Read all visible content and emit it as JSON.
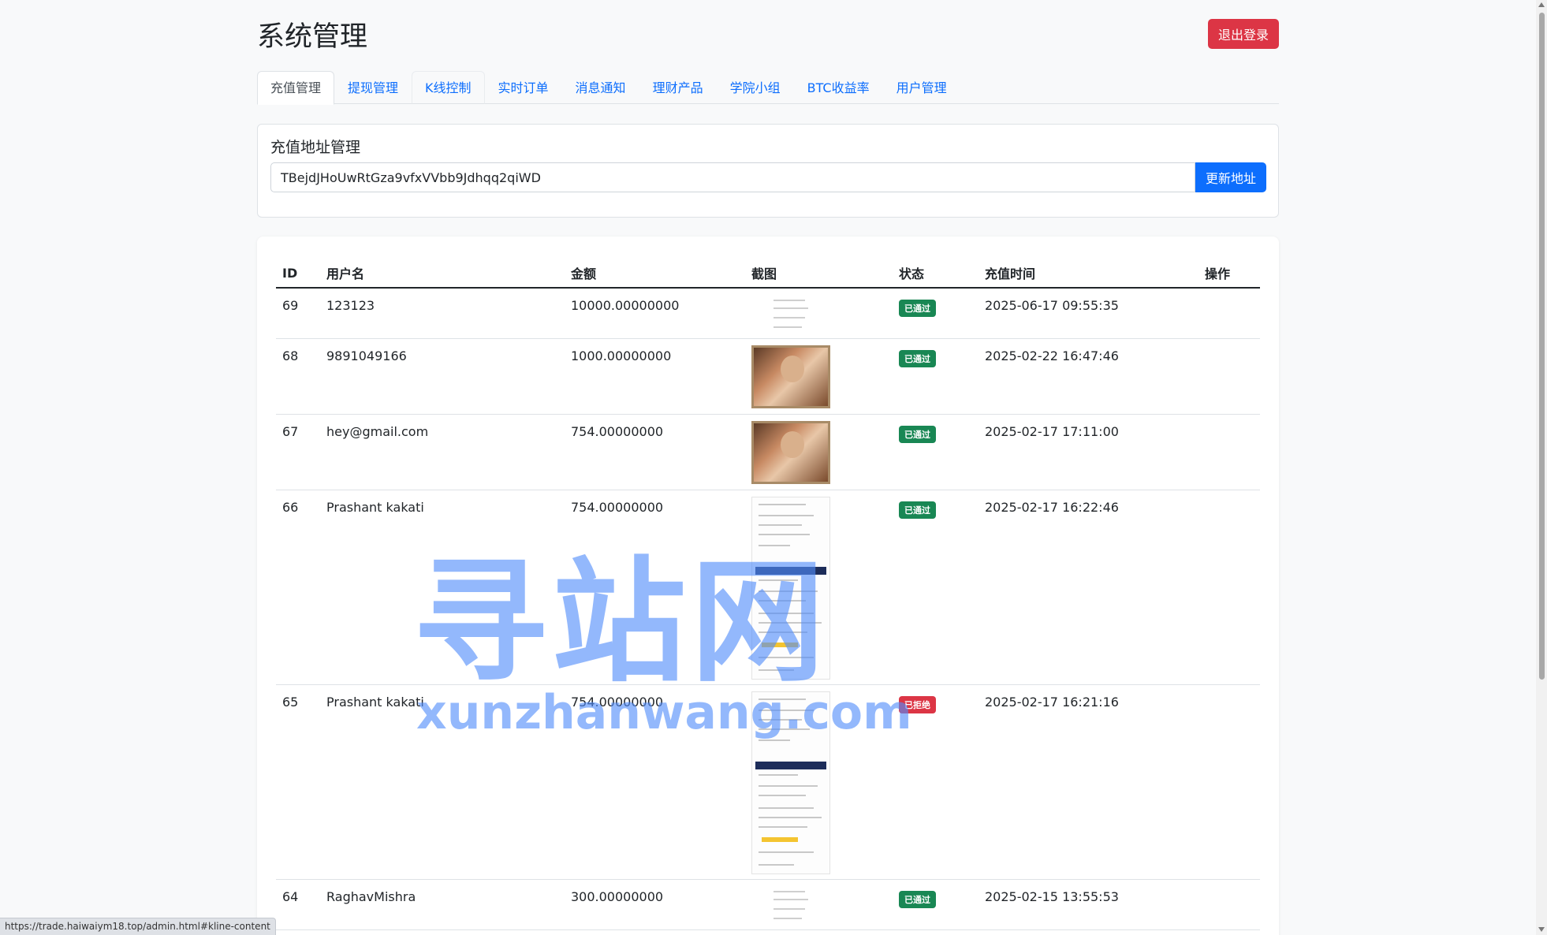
{
  "header": {
    "title": "系统管理",
    "logout_label": "退出登录"
  },
  "tabs": [
    {
      "label": "充值管理",
      "active": true
    },
    {
      "label": "提现管理"
    },
    {
      "label": "K线控制"
    },
    {
      "label": "实时订单"
    },
    {
      "label": "消息通知"
    },
    {
      "label": "理财产品"
    },
    {
      "label": "学院小组"
    },
    {
      "label": "BTC收益率"
    },
    {
      "label": "用户管理"
    }
  ],
  "address_card": {
    "title": "充值地址管理",
    "address_value": "TBejdJHoUwRtGza9vfxVVbb9Jdhqq2qiWD",
    "update_label": "更新地址"
  },
  "table": {
    "headers": [
      "ID",
      "用户名",
      "金额",
      "截图",
      "状态",
      "充值时间",
      "操作"
    ],
    "rows": [
      {
        "id": "69",
        "username": "123123",
        "amount": "10000.00000000",
        "status": "已通过",
        "status_type": "approved",
        "time": "2025-06-17 09:55:35",
        "shot": "mini"
      },
      {
        "id": "68",
        "username": "9891049166",
        "amount": "1000.00000000",
        "status": "已通过",
        "status_type": "approved",
        "time": "2025-02-22 16:47:46",
        "shot": "portrait"
      },
      {
        "id": "67",
        "username": "hey@gmail.com",
        "amount": "754.00000000",
        "status": "已通过",
        "status_type": "approved",
        "time": "2025-02-17 17:11:00",
        "shot": "portrait"
      },
      {
        "id": "66",
        "username": "Prashant kakati",
        "amount": "754.00000000",
        "status": "已通过",
        "status_type": "approved",
        "time": "2025-02-17 16:22:46",
        "shot": "receipt"
      },
      {
        "id": "65",
        "username": "Prashant kakati",
        "amount": "754.00000000",
        "status": "已拒绝",
        "status_type": "rejected",
        "time": "2025-02-17 16:21:16",
        "shot": "receipt"
      },
      {
        "id": "64",
        "username": "RaghavMishra",
        "amount": "300.00000000",
        "status": "已通过",
        "status_type": "approved",
        "time": "2025-02-15 13:55:53",
        "shot": "mini"
      }
    ]
  },
  "watermark": {
    "big": "寻站网",
    "small": "xunzhanwang.com"
  },
  "statusbar": {
    "url": "https://trade.haiwaiym18.top/admin.html#kline-content"
  },
  "colors": {
    "primary": "#0d6efd",
    "danger": "#dc3545",
    "success": "#198754",
    "background": "#f8f9fa"
  }
}
